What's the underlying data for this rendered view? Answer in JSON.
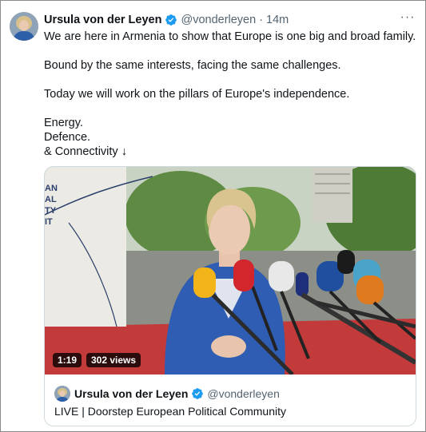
{
  "tweet": {
    "author_name": "Ursula von der Leyen",
    "handle": "@vonderleyen",
    "separator": "·",
    "time": "14m",
    "more_label": "···",
    "lines": [
      "We are here in Armenia to show that Europe is one big and broad family.",
      "Bound by the same interests, facing the same challenges.",
      "Today we will work on the pillars of Europe's independence.",
      "Energy.",
      "Defence.",
      "& Connectivity ↓"
    ]
  },
  "card": {
    "duration": "1:19",
    "views": "302 views",
    "author_name": "Ursula von der Leyen",
    "handle": "@vonderleyen",
    "title": "LIVE | Doorstep European Political Community"
  },
  "colors": {
    "verified": "#1d9bf0",
    "secondary_text": "#536471",
    "primary_text": "#0f1419",
    "border": "#cfd9de"
  }
}
